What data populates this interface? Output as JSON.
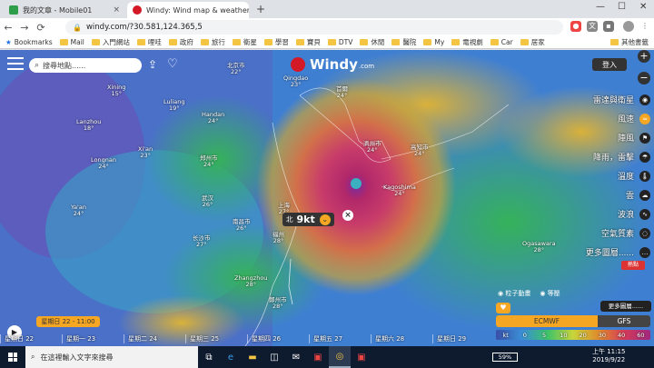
{
  "tabs": [
    {
      "title": "我的文章 - Mobile01",
      "favicon_color": "#2e9e4a",
      "close": "×"
    },
    {
      "title": "Windy: Wind map & weather fo",
      "favicon_color": "#d31925",
      "close": "×"
    }
  ],
  "newtab": "+",
  "window_controls": {
    "minimize": "—",
    "maximize": "☐",
    "close": "✕"
  },
  "nav": {
    "back": "←",
    "forward": "→",
    "reload": "⟳"
  },
  "address": {
    "lock": "🔒",
    "url": "windy.com/?30.581,124.365,5"
  },
  "bookmarks": {
    "apps_label": "Bookmarks",
    "items": [
      "Mail",
      "入門網站",
      "哩哇",
      "政府",
      "旅行",
      "衛星",
      "學習",
      "寶貝",
      "DTV",
      "休閒",
      "醫院",
      "My",
      "電視劇",
      "Car",
      "居家"
    ],
    "other": "其他書籤"
  },
  "map": {
    "search_placeholder": "搜尋地點......",
    "logo_text": "Windy",
    "logo_domain": ".com",
    "login": "登入",
    "zoom_in": "+",
    "zoom_out": "−",
    "layers": [
      {
        "label": "雷達與衛星",
        "icon": "◉",
        "active": false
      },
      {
        "label": "風速",
        "icon": "≈",
        "active": true
      },
      {
        "label": "陣風",
        "icon": "⚑",
        "active": false
      },
      {
        "label": "降雨，雷擊",
        "icon": "☂",
        "active": false
      },
      {
        "label": "溫度",
        "icon": "🌡",
        "active": false
      },
      {
        "label": "雲",
        "icon": "☁",
        "active": false
      },
      {
        "label": "波浪",
        "icon": "∿",
        "active": false
      },
      {
        "label": "空氣質素",
        "icon": "◌",
        "active": false
      },
      {
        "label": "更多圖層......",
        "icon": "…",
        "active": false
      }
    ],
    "more_badge": "熱點",
    "marker": {
      "direction": "北",
      "speed": "9kt"
    },
    "close_marker": "×",
    "particles_label": "粒子動畫",
    "isolines_label": "等壓",
    "more_layers": "更多圖層......",
    "model_ecmwf": "ECMWF",
    "model_gfs": "GFS",
    "legend": {
      "unit": "kt",
      "values": [
        "0",
        "5",
        "10",
        "20",
        "30",
        "40",
        "60"
      ]
    },
    "cities": [
      {
        "name": "北京市",
        "temp": "22°"
      },
      {
        "name": "Xining",
        "temp": "15°"
      },
      {
        "name": "Lanzhou",
        "temp": "18°"
      },
      {
        "name": "Luliang",
        "temp": "19°"
      },
      {
        "name": "Handan",
        "temp": "24°"
      },
      {
        "name": "郑州市",
        "temp": "24°"
      },
      {
        "name": "Longnan",
        "temp": "24°"
      },
      {
        "name": "Xi'an",
        "temp": "23°"
      },
      {
        "name": "武汉",
        "temp": "26°"
      },
      {
        "name": "Ya'an",
        "temp": "24°"
      },
      {
        "name": "长沙市",
        "temp": "27°"
      },
      {
        "name": "南昌市",
        "temp": "26°"
      },
      {
        "name": "Zhangzhou",
        "temp": "28°"
      },
      {
        "name": "鄭州市",
        "temp": "28°"
      },
      {
        "name": "Qingdao",
        "temp": "23°"
      },
      {
        "name": "首爾",
        "temp": "24°"
      },
      {
        "name": "濟州市",
        "temp": "24°"
      },
      {
        "name": "Kagoshima",
        "temp": "24°"
      },
      {
        "name": "高知市",
        "temp": "24°"
      },
      {
        "name": "Ogasawara",
        "temp": "28°"
      },
      {
        "name": "上海",
        "temp": "27°"
      },
      {
        "name": "福州",
        "temp": "28°"
      }
    ]
  },
  "timeline": {
    "play": "▶",
    "current": "星期日 22 - 11:00",
    "days": [
      "星期日 22",
      "星期一 23",
      "星期二 24",
      "星期三 25",
      "星期四 26",
      "星期五 27",
      "星期六 28",
      "星期日 29",
      "星期一 30",
      "星期二 1"
    ]
  },
  "taskbar": {
    "search_placeholder": "在這裡輸入文字來搜尋",
    "battery": "59%",
    "time": "上午 11:15",
    "date": "2019/9/22"
  }
}
